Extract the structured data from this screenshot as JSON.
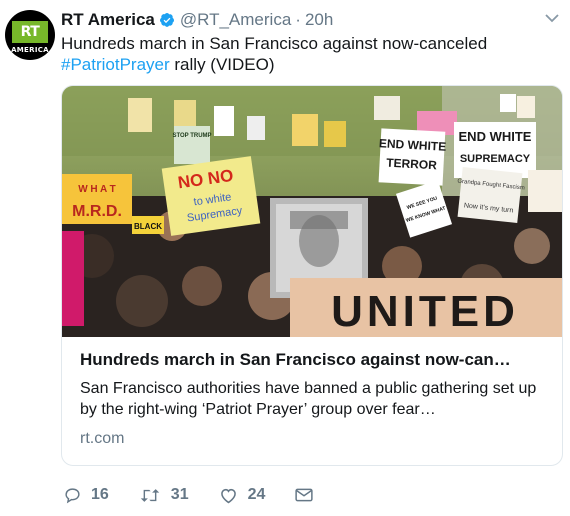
{
  "account": {
    "name": "RT America",
    "handle": "@RT_America",
    "separator": "·",
    "time": "20h",
    "avatar_logo": "RT",
    "avatar_sub": "AMERICA"
  },
  "tweet": {
    "text_before": "Hundreds march in San Francisco against now-canceled ",
    "hashtag": "#PatriotPrayer",
    "text_after": " rally (VIDEO)"
  },
  "card": {
    "image_signs": {
      "trump": "STOP TRUMP Shut Down white Supremacy",
      "murd": "W H A T  W O U L D  M.R.D.",
      "no": "NO NO to white Supremacy",
      "end1": "END WHITE TERROR",
      "end2": "END WHITE SUPREMACY",
      "united": "UNITED",
      "black": "BLACK",
      "grandpa": "Grandpa Fought Fascism Now it's my turn",
      "see": "WE SEE YOU AND WE KNOW WHAT YOU ARE",
      "fascism": "FASCISM"
    },
    "title": "Hundreds march in San Francisco against now-can…",
    "description": "San Francisco authorities have banned a public gathering set up by the right-wing ‘Patriot Prayer’ group over fear…",
    "domain": "rt.com"
  },
  "actions": {
    "replies": "16",
    "retweets": "31",
    "likes": "24"
  },
  "colors": {
    "accent": "#1da1f2",
    "muted": "#657786",
    "rt_green": "#77b82a"
  },
  "icons": [
    "verified-icon",
    "caret-down-icon",
    "reply-icon",
    "retweet-icon",
    "like-icon",
    "message-icon"
  ]
}
